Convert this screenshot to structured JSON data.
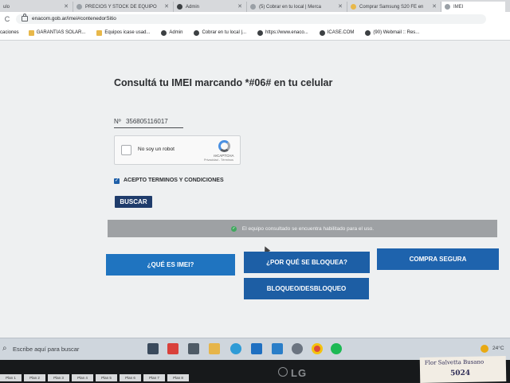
{
  "browser": {
    "tabs": [
      {
        "title": "ulo",
        "icon": "page-icon"
      },
      {
        "title": "PRECIOS Y STOCK DE EQUIPO",
        "icon": "page-icon"
      },
      {
        "title": "Admin",
        "icon": "admin-icon"
      },
      {
        "title": "(5) Cobrar en tu local | Merca",
        "icon": "page-icon"
      },
      {
        "title": "Comprar Samsung S20 FE en",
        "icon": "page-icon"
      },
      {
        "title": "IMEI",
        "icon": "page-icon"
      }
    ],
    "url": "enacom.gob.ar/imei#contenedorSitio",
    "bookmarks": [
      {
        "label": "caciones",
        "icon": "none"
      },
      {
        "label": "GARANTIAS SOLAR...",
        "icon": "folder-icon"
      },
      {
        "label": "Equipos icase usad...",
        "icon": "folder-icon"
      },
      {
        "label": "Admin",
        "icon": "admin-icon"
      },
      {
        "label": "Cobrar en tu local |...",
        "icon": "web-icon"
      },
      {
        "label": "https://www.enaco...",
        "icon": "web-icon"
      },
      {
        "label": "ICASE.COM",
        "icon": "web-icon"
      },
      {
        "label": "(90) Webmail :: Res...",
        "icon": "web-icon"
      }
    ]
  },
  "page": {
    "title": "Consultá tu IMEI marcando *#06# en tu celular",
    "imei_label": "Nº",
    "imei_value": "356805116017",
    "captcha": {
      "label": "No soy un robot",
      "brand": "reCAPTCHA",
      "links": "Privacidad - Términos"
    },
    "terms_label": "ACEPTO TERMINOS Y CONDICIONES",
    "terms_checked": true,
    "search_button": "BUSCAR",
    "status_message": "El equipo consultado se encuentra habilitado para el uso.",
    "buttons": {
      "imei": "¿QUÉ ES IMEI?",
      "bloquea": "¿POR QUÉ SE BLOQUEA?",
      "compra": "COMPRA SEGURA",
      "bloqueo": "BLOQUEO/DESBLOQUEO"
    }
  },
  "taskbar": {
    "search_placeholder": "Escribe aquí para buscar",
    "temperature": "24°C",
    "apps": [
      "task-view-icon",
      "media-icon",
      "calculator-icon",
      "file-explorer-icon",
      "edge-icon",
      "mail-icon",
      "store-icon",
      "app-icon",
      "chrome-icon",
      "spotify-icon"
    ]
  },
  "desk": {
    "monitor_brand": "LG",
    "sheet_tabs": [
      "Plan 1",
      "Plan 2",
      "Plan 3",
      "Plan 4",
      "Plan 5",
      "Plan 6",
      "Plan 7",
      "Plan 8"
    ],
    "note_line1": "Flor Salvetta Busano",
    "note_line2": "5024"
  },
  "colors": {
    "primary_button": "#1f6bb3",
    "search_button": "#1f3c6b",
    "status_banner": "#9ea1a4",
    "success": "#41a85f"
  }
}
